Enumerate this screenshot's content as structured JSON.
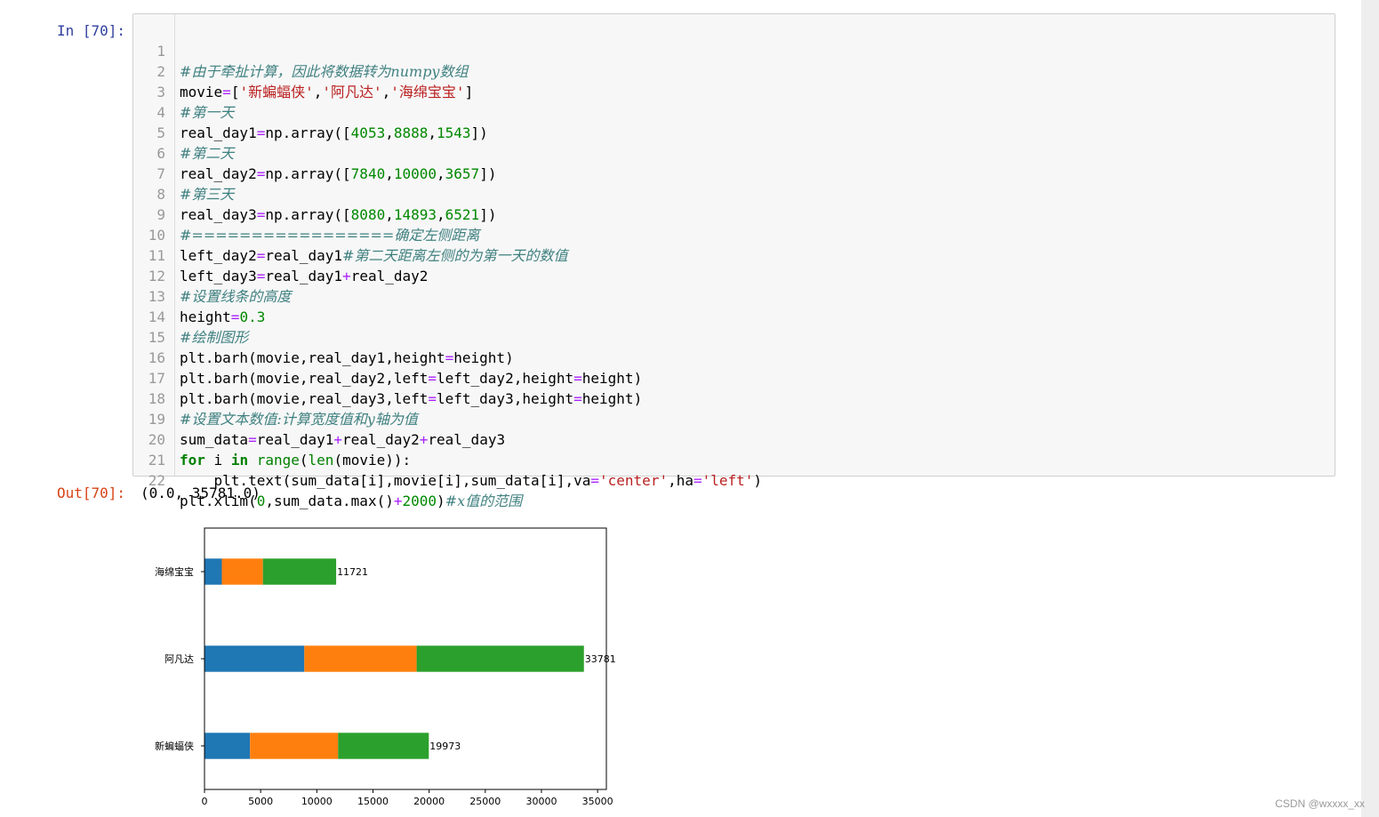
{
  "cells": {
    "in_prompt": "In  [70]:",
    "out_prompt": "Out[70]:",
    "out_text": "(0.0,  35781.0)"
  },
  "code": {
    "line_numbers": [
      "1",
      "2",
      "3",
      "4",
      "5",
      "6",
      "7",
      "8",
      "9",
      "10",
      "11",
      "12",
      "13",
      "14",
      "15",
      "16",
      "17",
      "18",
      "19",
      "20",
      "21",
      "22"
    ],
    "l1_c": "#由于牵扯计算，因此将数据转为numpy数组",
    "l2_a": "movie",
    "l2_b": "=",
    "l2_c": "[",
    "l2_d": "'新蝙蝠侠'",
    "l2_e": ",",
    "l2_f": "'阿凡达'",
    "l2_g": ",",
    "l2_h": "'海绵宝宝'",
    "l2_i": "]",
    "l3_c": "#第一天",
    "l4_a": "real_day1",
    "l4_b": "=",
    "l4_c": "np.array([",
    "l4_d": "4053",
    "l4_e": ",",
    "l4_f": "8888",
    "l4_g": ",",
    "l4_h": "1543",
    "l4_i": "])",
    "l5_c": "#第二天",
    "l6_a": "real_day2",
    "l6_b": "=",
    "l6_c": "np.array([",
    "l6_d": "7840",
    "l6_e": ",",
    "l6_f": "10000",
    "l6_g": ",",
    "l6_h": "3657",
    "l6_i": "])",
    "l7_c": "#第三天",
    "l8_a": "real_day3",
    "l8_b": "=",
    "l8_c": "np.array([",
    "l8_d": "8080",
    "l8_e": ",",
    "l8_f": "14893",
    "l8_g": ",",
    "l8_h": "6521",
    "l8_i": "])",
    "l9_c": "#=================确定左侧距离",
    "l10_a": "left_day2",
    "l10_b": "=",
    "l10_c": "real_day1",
    "l10_d": "#第二天距离左侧的为第一天的数值",
    "l11_a": "left_day3",
    "l11_b": "=",
    "l11_c": "real_day1",
    "l11_d": "+",
    "l11_e": "real_day2",
    "l12_c": "#设置线条的高度",
    "l13_a": "height",
    "l13_b": "=",
    "l13_c": "0.3",
    "l14_c": "#绘制图形",
    "l15_a": "plt.barh(movie,real_day1,height",
    "l15_b": "=",
    "l15_c": "height)",
    "l16_a": "plt.barh(movie,real_day2,left",
    "l16_b": "=",
    "l16_c": "left_day2,height",
    "l16_d": "=",
    "l16_e": "height)",
    "l17_a": "plt.barh(movie,real_day3,left",
    "l17_b": "=",
    "l17_c": "left_day3,height",
    "l17_d": "=",
    "l17_e": "height)",
    "l18_c": "#设置文本数值:计算宽度值和y轴为值",
    "l19_a": "sum_data",
    "l19_b": "=",
    "l19_c": "real_day1",
    "l19_d": "+",
    "l19_e": "real_day2",
    "l19_f": "+",
    "l19_g": "real_day3",
    "l20_a": "for",
    "l20_b": " i ",
    "l20_c": "in",
    "l20_d": " ",
    "l20_e": "range",
    "l20_f": "(",
    "l20_g": "len",
    "l20_h": "(movie)):",
    "l21_a": "    plt.text(sum_data[i],movie[i],sum_data[i],va",
    "l21_b": "=",
    "l21_c": "'center'",
    "l21_d": ",ha",
    "l21_e": "=",
    "l21_f": "'left'",
    "l21_g": ")",
    "l22_a": "plt.xlim(",
    "l22_b": "0",
    "l22_c": ",sum_data.max()",
    "l22_d": "+",
    "l22_e": "2000",
    "l22_f": ")",
    "l22_g": "#x值的范围"
  },
  "chart_data": {
    "type": "bar",
    "orientation": "horizontal",
    "stacked": true,
    "categories": [
      "新蝙蝠侠",
      "阿凡达",
      "海绵宝宝"
    ],
    "series": [
      {
        "values": [
          4053,
          8888,
          1543
        ],
        "color": "#1f77b4"
      },
      {
        "values": [
          7840,
          10000,
          3657
        ],
        "color": "#ff7f0e"
      },
      {
        "values": [
          8080,
          14893,
          6521
        ],
        "color": "#2ca02c"
      }
    ],
    "totals": [
      "19973",
      "33781",
      "11721"
    ],
    "xticks": [
      0,
      5000,
      10000,
      15000,
      20000,
      25000,
      30000,
      35000
    ],
    "xtick_labels": [
      "0",
      "5000",
      "10000",
      "15000",
      "20000",
      "25000",
      "30000",
      "35000"
    ],
    "xlim": [
      0,
      35781
    ],
    "bar_height": 0.3,
    "grid": false,
    "legend": "none"
  },
  "footer": {
    "watermark": "CSDN @wxxxx_xx"
  }
}
